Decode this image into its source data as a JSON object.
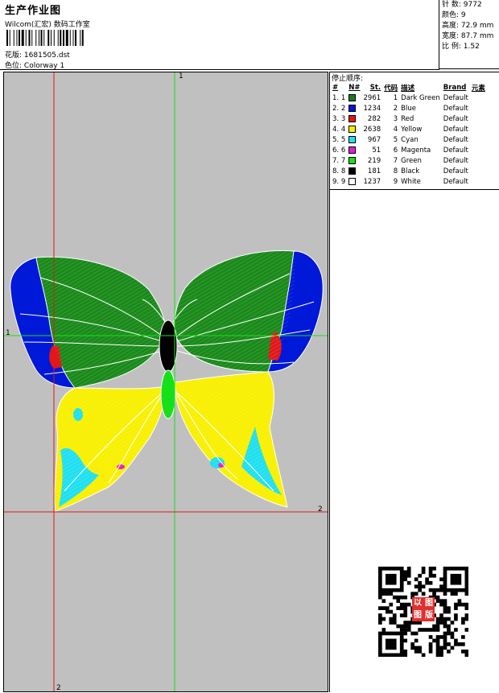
{
  "header": {
    "title": "生产作业图",
    "company": "Wilcom(汇宏)  数码工作室",
    "design_label": "花版:",
    "design_value": "1681505.dst",
    "colorway_label": "色位:",
    "colorway_value": "Colorway 1"
  },
  "stats": {
    "stitches_label": "针 数:",
    "stitches_value": "9772",
    "colors_label": "颜色:",
    "colors_value": "9",
    "height_label": "高度:",
    "height_value": "72.9 mm",
    "width_label": "宽度:",
    "width_value": "87.7 mm",
    "scale_label": "比 例:",
    "scale_value": "1.52"
  },
  "stop_sequence": {
    "title": "停止顺序:",
    "headers": [
      "#",
      "N#",
      "St.",
      "代码",
      "描述",
      "Brand",
      "元素"
    ],
    "rows": [
      {
        "idx": "1.",
        "n": "1",
        "color": "#1a7a1a",
        "st": "2961",
        "code": "1",
        "desc": "Dark Green",
        "brand": "Default"
      },
      {
        "idx": "2.",
        "n": "2",
        "color": "#0018d8",
        "st": "1234",
        "code": "2",
        "desc": "Blue",
        "brand": "Default"
      },
      {
        "idx": "3.",
        "n": "3",
        "color": "#e01818",
        "st": "282",
        "code": "3",
        "desc": "Red",
        "brand": "Default"
      },
      {
        "idx": "4.",
        "n": "4",
        "color": "#f8f000",
        "st": "2638",
        "code": "4",
        "desc": "Yellow",
        "brand": "Default"
      },
      {
        "idx": "5.",
        "n": "5",
        "color": "#20e0f0",
        "st": "967",
        "code": "5",
        "desc": "Cyan",
        "brand": "Default"
      },
      {
        "idx": "6.",
        "n": "6",
        "color": "#e020d0",
        "st": "51",
        "code": "6",
        "desc": "Magenta",
        "brand": "Default"
      },
      {
        "idx": "7.",
        "n": "7",
        "color": "#18e018",
        "st": "219",
        "code": "7",
        "desc": "Green",
        "brand": "Default"
      },
      {
        "idx": "8.",
        "n": "8",
        "color": "#000000",
        "st": "181",
        "code": "8",
        "desc": "Black",
        "brand": "Default"
      },
      {
        "idx": "9.",
        "n": "9",
        "color": "#ffffff",
        "st": "1237",
        "code": "9",
        "desc": "White",
        "brand": "Default"
      }
    ]
  },
  "guides": {
    "top_label": "1",
    "left_label": "1",
    "right_label": "2",
    "bottom_label": "2"
  },
  "stamp": {
    "chars": [
      "以",
      "图",
      "图",
      "版"
    ]
  }
}
